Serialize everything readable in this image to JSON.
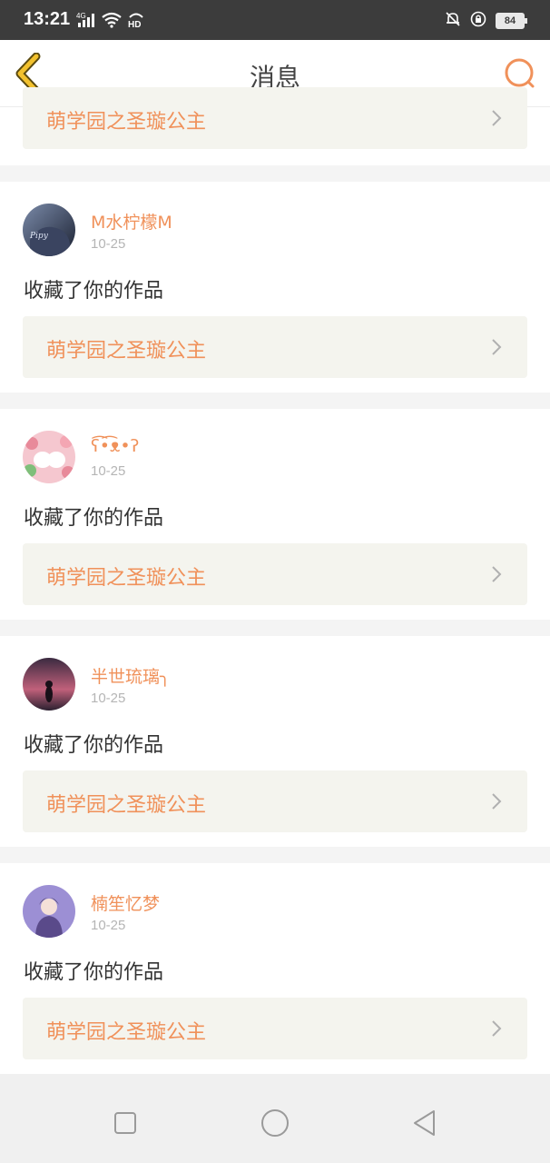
{
  "status_bar": {
    "time": "13:21",
    "network": "4G",
    "hd": "HD",
    "battery": "84"
  },
  "header": {
    "title": "消息"
  },
  "partial_card": {
    "work_title": "萌学园之圣璇公主"
  },
  "notifications": [
    {
      "username": "M水柠檬M",
      "date": "10-25",
      "action": "收藏了你的作品",
      "work_title": "萌学园之圣璇公主",
      "avatar_colors": [
        "#2c3550",
        "#7a8aa8"
      ]
    },
    {
      "username": "ʕ͡•͡ᴥ•ʔ",
      "date": "10-25",
      "action": "收藏了你的作品",
      "work_title": "萌学园之圣璇公主",
      "avatar_colors": [
        "#f5c7cf",
        "#7fbf7a"
      ]
    },
    {
      "username": "半世琉璃╮",
      "date": "10-25",
      "action": "收藏了你的作品",
      "work_title": "萌学园之圣璇公主",
      "avatar_colors": [
        "#c0607a",
        "#2b2030"
      ]
    },
    {
      "username": "楠笙忆梦",
      "date": "10-25",
      "action": "收藏了你的作品",
      "work_title": "萌学园之圣璇公主",
      "avatar_colors": [
        "#9c8fd4",
        "#5a4a8a"
      ]
    }
  ],
  "colors": {
    "accent": "#f0915a",
    "back_icon": "#f2c12e",
    "link_bg": "#f4f4ee"
  }
}
